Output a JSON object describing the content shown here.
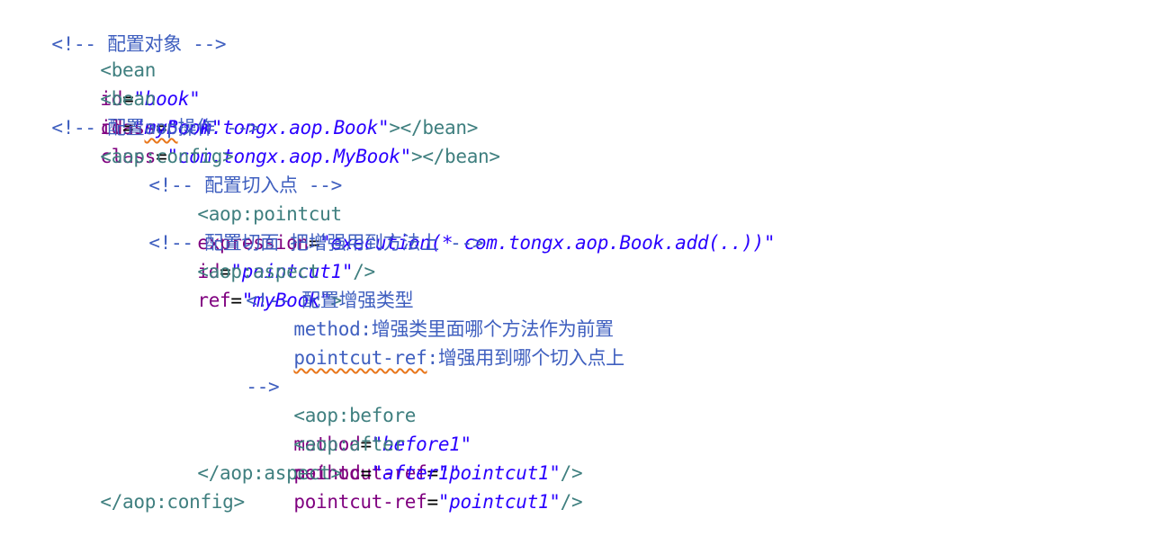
{
  "editor": {
    "lines": [
      {
        "comment": "<!-- 配置对象 -->"
      },
      {
        "tag_open": "<bean",
        "attrs": [
          {
            "name": "id",
            "value": "\"book\""
          },
          {
            "name": "class",
            "value": "\"com.tongx.aop.Book\""
          }
        ],
        "tag_close": "></bean>"
      },
      {
        "tag_open": "<bean",
        "attrs": [
          {
            "name": "id",
            "value": "\"myBook\""
          },
          {
            "name": "class",
            "value": "\"com.tongx.aop.MyBook\""
          }
        ],
        "tag_close": "></bean>"
      },
      {
        "comment_before": "<!-- 配置",
        "comment_squiggle": "aop",
        "comment_after": "操作 -->"
      },
      {
        "tag": "<aop:config>"
      },
      {
        "comment": "<!-- 配置切入点 -->"
      },
      {
        "tag_open": "<aop:pointcut",
        "attrs": [
          {
            "name": "expression",
            "value": "\"execution(* com.tongx.aop.Book.add(..))\""
          },
          {
            "name": "id",
            "value": "\"pointcut1\""
          }
        ],
        "tag_close": "/>"
      },
      {
        "comment": "<!-- 配置切面 把增强用到方法上 -->"
      },
      {
        "tag_open": "<aop:aspect",
        "attrs": [
          {
            "name": "ref",
            "value": "\"myBook\""
          }
        ],
        "tag_close": ">"
      },
      {
        "comment": "<!-- 配置增强类型"
      },
      {
        "comment": "method:增强类里面哪个方法作为前置"
      },
      {
        "comment_squiggle": "pointcut-ref",
        "comment_after": ":增强用到哪个切入点上"
      },
      {
        "comment": "-->"
      },
      {
        "tag_open": "<aop:before",
        "attrs": [
          {
            "name": "method",
            "value": "\"before1\""
          },
          {
            "name": "pointcut-ref",
            "value": "\"pointcut1\""
          }
        ],
        "tag_close": "/>"
      },
      {
        "tag_open": "<aop:after",
        "attrs": [
          {
            "name": "method",
            "value": "\"after1\""
          },
          {
            "name": "pointcut-ref",
            "value": "\"pointcut1\""
          }
        ],
        "tag_close": "/>"
      },
      {
        "tag": "</aop:aspect>"
      },
      {
        "tag": "</aop:config>"
      }
    ]
  }
}
